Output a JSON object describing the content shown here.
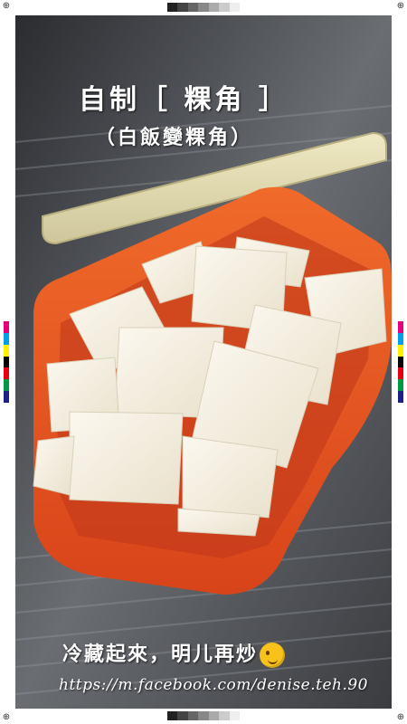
{
  "title": "自制［ 粿角 ］",
  "subtitle": "（白飯變粿角）",
  "caption": "冷藏起來，明儿再炒",
  "watermark_url": "https://m.facebook.com/denise.teh.90",
  "icons": {
    "emoji": "winking-face-emoji",
    "crosshair": "registration-mark-icon"
  },
  "colors": {
    "container_orange": "#e8501c",
    "lid": "#e8e2b8",
    "rice_cake": "#f4efe2",
    "background_metal": "#4a4d52"
  }
}
